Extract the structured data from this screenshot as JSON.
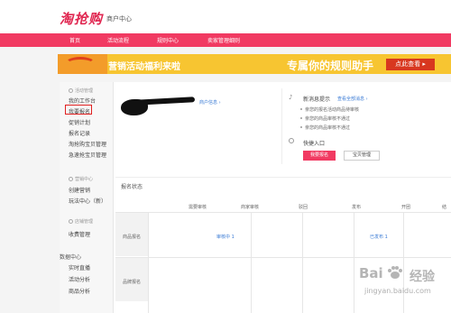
{
  "header": {
    "logo": "淘抢购",
    "subtitle": "商户中心"
  },
  "nav": {
    "items": [
      {
        "label": "首页"
      },
      {
        "label": "活动流程"
      },
      {
        "label": "规则中心"
      },
      {
        "label": "卖家管理细则"
      }
    ]
  },
  "banner": {
    "text_left": "营销活动福利来啦",
    "text_main": "专属你的规则助手",
    "button": "点此查看 ▸"
  },
  "sidebar": {
    "sections": [
      {
        "title": "活动管理",
        "items": [
          "我的工作台",
          "我要报名",
          "促销计划",
          "报名记录",
          "淘抢购宝贝管理",
          "急速抢宝贝管理"
        ]
      },
      {
        "title": "营销中心",
        "items": [
          "创建营销",
          "玩法中心（新）"
        ]
      },
      {
        "title": "店铺管理",
        "items": [
          "收费管理"
        ]
      },
      {
        "title": "数据中心",
        "items": [
          "实时直播",
          "活动分析",
          "商品分析"
        ]
      }
    ]
  },
  "user": {
    "link": "商户信息 ›"
  },
  "notices": {
    "title": "新消息提示",
    "more": "查看全部消息 ›",
    "items": [
      "亲您的报名活动商品待审核",
      "亲您的商品审核不通过",
      "亲您的商品审核不通过"
    ]
  },
  "quick": {
    "title": "快捷入口",
    "primary": "我要报名",
    "secondary": "宝贝管理"
  },
  "status": {
    "title": "报名状态",
    "columns": [
      "需要审核",
      "商家审核",
      "驳回",
      "发布",
      "开团",
      "结"
    ],
    "rows": [
      {
        "label": "商品报名",
        "cells": [
          "审核中 1",
          "",
          "",
          "已发布 1",
          "",
          ""
        ]
      },
      {
        "label": "品牌报名",
        "cells": [
          "",
          "",
          "",
          "",
          "",
          ""
        ]
      }
    ]
  },
  "watermark": {
    "brand": "Bai",
    "brand_cn": "经验",
    "domain": "jingyan.baidu.com"
  },
  "colors": {
    "accent": "#f13a62",
    "logo": "#e02650",
    "banner": "#f7c531",
    "link": "#3a7bd5",
    "highlight_box": "#e02020"
  }
}
